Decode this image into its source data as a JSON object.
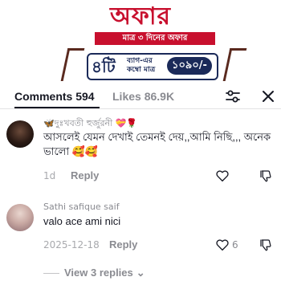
{
  "ad": {
    "title": "অফার",
    "subtitle": "মাত্র ৩ দিনের অফার",
    "count": "৪টি",
    "description": "ব্যাগ-এর কম্বো মাত্র",
    "price": "১০৯০/-",
    "brand_color": "#c8102e",
    "accent_color": "#1b2a59"
  },
  "header": {
    "comments_label": "Comments 594",
    "likes_label": "Likes 86.9K",
    "icons": [
      "filter-sliders-icon",
      "close-icon"
    ]
  },
  "comments": [
    {
      "username": "🦋দুঃখবতী হুর্জুরনী 💝🌹",
      "text": "আসলেই যেমন দেখাই তেমনই দেয়,,আমি নিছি,,, অনেক ভালো 🥰🥰",
      "time": "1d",
      "reply_label": "Reply",
      "likes": ""
    },
    {
      "username": "Sathi safique saif",
      "text": "valo ace ami nici",
      "time": "2025-12-18",
      "reply_label": "Reply",
      "likes": "6"
    }
  ],
  "view_replies_label": "View 3 replies",
  "colors": {
    "text_primary": "#161823",
    "text_secondary": "#8a8b91",
    "divider": "#e3e3e4"
  }
}
